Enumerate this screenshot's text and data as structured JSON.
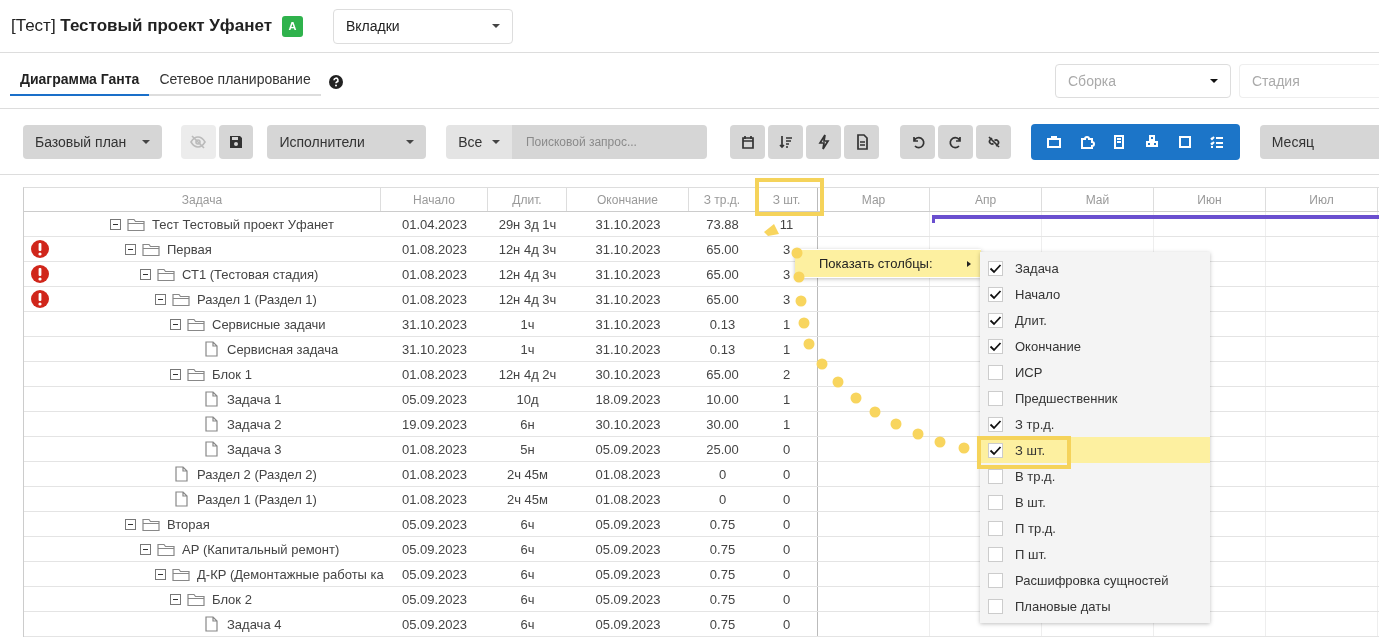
{
  "header": {
    "title": "[Тест] **Тестовый проект Уфанет**",
    "badge": "A",
    "tabs_dropdown": "Вкладки"
  },
  "tabs": [
    {
      "label": "Диаграмма Ганта",
      "selected": true
    },
    {
      "label": "Сетевое планирование",
      "selected": false
    }
  ],
  "filters": {
    "assembly_placeholder": "Сборка",
    "stage_placeholder": "Стадия"
  },
  "toolbar": {
    "baseline": "Базовый план",
    "visibility_disabled": true,
    "performers": "Исполнители",
    "scope": "Все",
    "search_placeholder": "Поисковой запрос...",
    "scale": "Месяц"
  },
  "table": {
    "columns": [
      "Задача",
      "Начало",
      "Длит.",
      "Окончание",
      "З тр.д.",
      "З шт."
    ],
    "months": [
      "Мар",
      "Апр",
      "Май",
      "Июн",
      "Июл"
    ],
    "rows": [
      {
        "name": "Тест Тестовый проект Уфанет",
        "kind": "folder",
        "expanded": true,
        "warning": false,
        "start": "01.04.2023",
        "duration": "29н 3д 1ч",
        "end": "31.10.2023",
        "labor": "73.88",
        "pieces": "11",
        "children": [
          {
            "name": "Первая",
            "kind": "folder",
            "expanded": true,
            "warning": true,
            "start": "01.08.2023",
            "duration": "12н 4д 3ч",
            "end": "31.10.2023",
            "labor": "65.00",
            "pieces": "3",
            "children": [
              {
                "name": "СТ1 (Тестовая стадия)",
                "kind": "folder",
                "expanded": true,
                "warning": true,
                "start": "01.08.2023",
                "duration": "12н 4д 3ч",
                "end": "31.10.2023",
                "labor": "65.00",
                "pieces": "3",
                "children": [
                  {
                    "name": "Раздел 1 (Раздел 1)",
                    "kind": "folder",
                    "expanded": true,
                    "warning": true,
                    "start": "01.08.2023",
                    "duration": "12н 4д 3ч",
                    "end": "31.10.2023",
                    "labor": "65.00",
                    "pieces": "3",
                    "children": [
                      {
                        "name": "Сервисные задачи",
                        "kind": "folder",
                        "expanded": true,
                        "warning": false,
                        "start": "31.10.2023",
                        "duration": "1ч",
                        "end": "31.10.2023",
                        "labor": "0.13",
                        "pieces": "1",
                        "children": [
                          {
                            "name": "Сервисная задача",
                            "kind": "file",
                            "warning": false,
                            "start": "31.10.2023",
                            "duration": "1ч",
                            "end": "31.10.2023",
                            "labor": "0.13",
                            "pieces": "1"
                          }
                        ]
                      },
                      {
                        "name": "Блок 1",
                        "kind": "folder",
                        "expanded": true,
                        "warning": false,
                        "start": "01.08.2023",
                        "duration": "12н 4д 2ч",
                        "end": "30.10.2023",
                        "labor": "65.00",
                        "pieces": "2",
                        "children": [
                          {
                            "name": "Задача 1",
                            "kind": "file",
                            "warning": false,
                            "start": "05.09.2023",
                            "duration": "10д",
                            "end": "18.09.2023",
                            "labor": "10.00",
                            "pieces": "1"
                          },
                          {
                            "name": "Задача 2",
                            "kind": "file",
                            "warning": false,
                            "start": "19.09.2023",
                            "duration": "6н",
                            "end": "30.10.2023",
                            "labor": "30.00",
                            "pieces": "1"
                          },
                          {
                            "name": "Задача 3",
                            "kind": "file",
                            "warning": false,
                            "start": "01.08.2023",
                            "duration": "5н",
                            "end": "05.09.2023",
                            "labor": "25.00",
                            "pieces": "0"
                          }
                        ]
                      }
                    ]
                  },
                  {
                    "name": "Раздел 2 (Раздел 2)",
                    "kind": "file",
                    "warning": false,
                    "start": "01.08.2023",
                    "duration": "2ч 45м",
                    "end": "01.08.2023",
                    "labor": "0",
                    "pieces": "0"
                  },
                  {
                    "name": "Раздел 1 (Раздел 1)",
                    "kind": "file",
                    "warning": false,
                    "start": "01.08.2023",
                    "duration": "2ч 45м",
                    "end": "01.08.2023",
                    "labor": "0",
                    "pieces": "0"
                  }
                ]
              }
            ]
          },
          {
            "name": "Вторая",
            "kind": "folder",
            "expanded": true,
            "warning": false,
            "start": "05.09.2023",
            "duration": "6ч",
            "end": "05.09.2023",
            "labor": "0.75",
            "pieces": "0",
            "children": [
              {
                "name": "АР (Капитальный ремонт)",
                "kind": "folder",
                "expanded": true,
                "warning": false,
                "start": "05.09.2023",
                "duration": "6ч",
                "end": "05.09.2023",
                "labor": "0.75",
                "pieces": "0",
                "children": [
                  {
                    "name": "Д-КР (Демонтажные работы ка",
                    "kind": "folder",
                    "expanded": true,
                    "warning": false,
                    "start": "05.09.2023",
                    "duration": "6ч",
                    "end": "05.09.2023",
                    "labor": "0.75",
                    "pieces": "0",
                    "children": [
                      {
                        "name": "Блок 2",
                        "kind": "folder",
                        "expanded": true,
                        "warning": false,
                        "start": "05.09.2023",
                        "duration": "6ч",
                        "end": "05.09.2023",
                        "labor": "0.75",
                        "pieces": "0",
                        "children": [
                          {
                            "name": "Задача 4",
                            "kind": "file",
                            "warning": false,
                            "start": "05.09.2023",
                            "duration": "6ч",
                            "end": "05.09.2023",
                            "labor": "0.75",
                            "pieces": "0"
                          }
                        ]
                      }
                    ]
                  }
                ]
              }
            ]
          }
        ]
      }
    ]
  },
  "context_menu": {
    "item": {
      "label": "Показать столбцы:",
      "selected": true
    },
    "submenu": [
      {
        "label": "Задача",
        "checked": true,
        "selected": false
      },
      {
        "label": "Начало",
        "checked": true,
        "selected": false
      },
      {
        "label": "Длит.",
        "checked": true,
        "selected": false
      },
      {
        "label": "Окончание",
        "checked": true,
        "selected": false
      },
      {
        "label": "ИСР",
        "checked": false,
        "selected": false
      },
      {
        "label": "Предшественник",
        "checked": false,
        "selected": false
      },
      {
        "label": "З тр.д.",
        "checked": true,
        "selected": false
      },
      {
        "label": "З шт.",
        "checked": true,
        "selected": true
      },
      {
        "label": "В тр.д.",
        "checked": false,
        "selected": false
      },
      {
        "label": "В шт.",
        "checked": false,
        "selected": false
      },
      {
        "label": "П тр.д.",
        "checked": false,
        "selected": false
      },
      {
        "label": "П шт.",
        "checked": false,
        "selected": false
      },
      {
        "label": "Расшифровка сущностей",
        "checked": false,
        "selected": false
      },
      {
        "label": "Плановые даты",
        "checked": false,
        "selected": false
      }
    ]
  }
}
